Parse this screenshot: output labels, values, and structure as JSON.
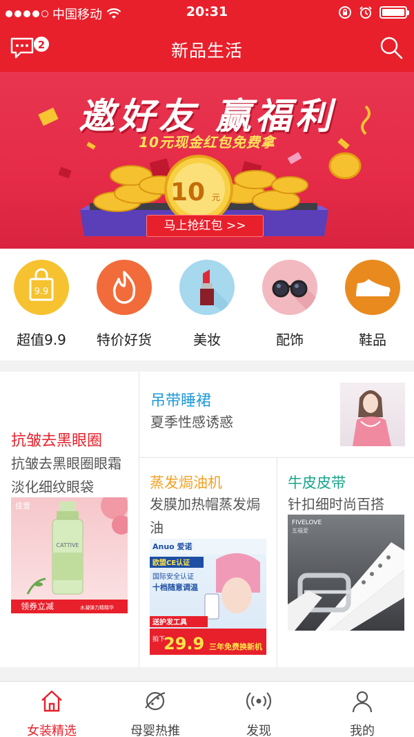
{
  "status_bar": {
    "carrier": "中国移动",
    "time": "20:31",
    "battery_level": 1.0
  },
  "nav": {
    "title": "新品生活",
    "message_badge": "2"
  },
  "banner": {
    "headline": "邀好友 赢福利",
    "subline": "10元现金红包免费拿",
    "coin_amount": "10",
    "coin_unit": "元",
    "button_label": "马上抢红包 >>"
  },
  "categories": [
    {
      "label": "超值9.9",
      "icon": "shopping-bag-icon",
      "color": "#f6c230",
      "badge_text": "9.9"
    },
    {
      "label": "特价好货",
      "icon": "flame-icon",
      "color": "#f26b3a"
    },
    {
      "label": "美妆",
      "icon": "lipstick-icon",
      "color": "#a6d8ee"
    },
    {
      "label": "配饰",
      "icon": "sunglasses-icon",
      "color": "#f3b9c0"
    },
    {
      "label": "鞋品",
      "icon": "sneaker-icon",
      "color": "#e98a1e"
    }
  ],
  "products": {
    "left": {
      "title": "抗皱去黑眼圈",
      "desc": "抗皱去黑眼圈眼霜淡化细纹眼袋",
      "title_color": "#e8202b",
      "image": {
        "brand": "佳雪",
        "bottle_brand": "CATTIVE",
        "coupon": "领券立减",
        "caption": "水凝弹力精精华"
      }
    },
    "top_right": {
      "title": "吊带睡裙",
      "desc": "夏季性感诱惑",
      "title_color": "#1f9bd8"
    },
    "mid": {
      "title": "蒸发焗油机",
      "desc": "发膜加热帽蒸发焗油",
      "title_color": "#f2a11f",
      "image": {
        "brand": "Anuo 爱诺",
        "cert": "欧盟CE认证",
        "line1": "国际安全认证",
        "line2": "十档随意调温",
        "promo": "送护发工具",
        "price_label": "拍下",
        "price": "29.9",
        "warranty": "三年免费换新机"
      }
    },
    "right": {
      "title": "牛皮皮带",
      "desc": "针扣细时尚百搭",
      "title_color": "#17a589",
      "image": {
        "brand": "FIVELOVE",
        "brand_cn": "五福爱"
      }
    }
  },
  "tabs": [
    {
      "label": "女装精选",
      "icon": "home-icon",
      "active": true
    },
    {
      "label": "母婴热推",
      "icon": "planet-icon",
      "active": false
    },
    {
      "label": "发现",
      "icon": "broadcast-icon",
      "active": false
    },
    {
      "label": "我的",
      "icon": "user-icon",
      "active": false
    }
  ],
  "colors": {
    "brand_red": "#e8202b"
  }
}
